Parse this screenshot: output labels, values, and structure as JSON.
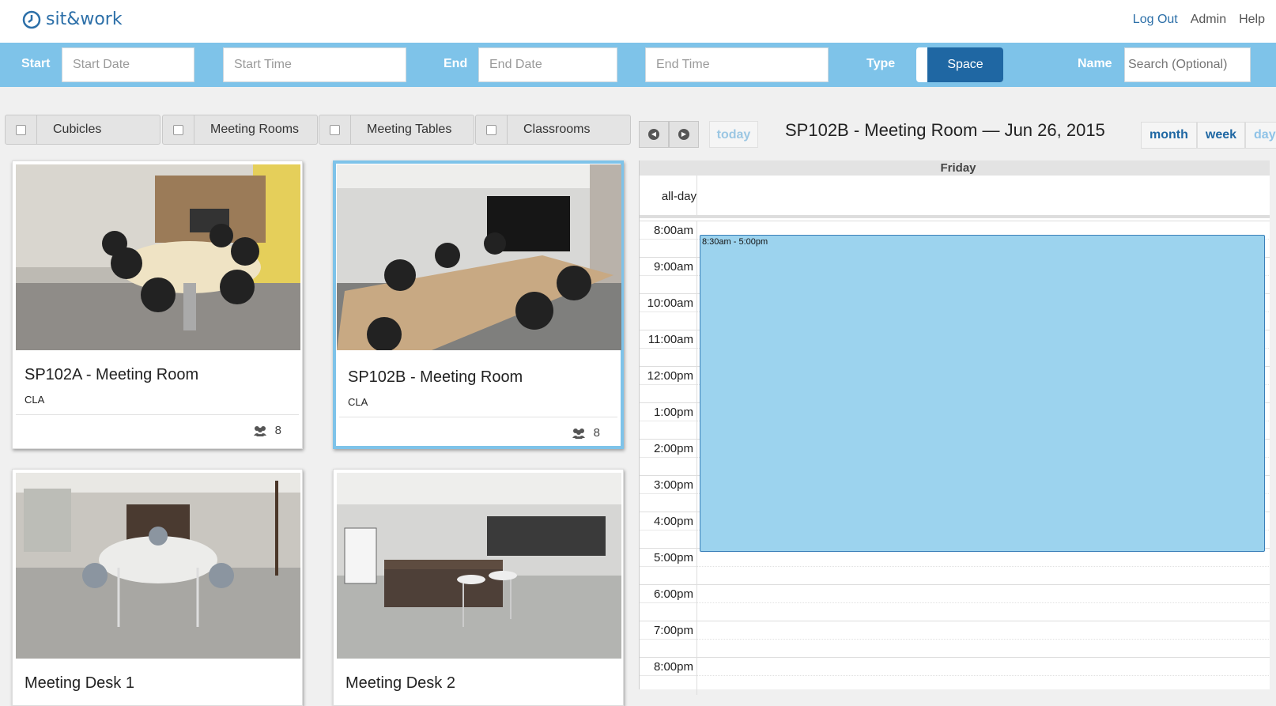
{
  "header": {
    "logo_text": "sit&work",
    "links": {
      "logout": "Log Out",
      "admin": "Admin",
      "help": "Help"
    }
  },
  "filters": {
    "start_label": "Start",
    "start_date_placeholder": "Start Date",
    "start_time_placeholder": "Start Time",
    "end_label": "End",
    "end_date_placeholder": "End Date",
    "end_time_placeholder": "End Time",
    "type_label": "Type",
    "type_value": "Space",
    "name_label": "Name",
    "name_placeholder": "Search (Optional)"
  },
  "categories": [
    "Cubicles",
    "Meeting Rooms",
    "Meeting Tables",
    "Classrooms"
  ],
  "cards": [
    {
      "title": "SP102A - Meeting Room",
      "subtitle": "CLA",
      "capacity": "8"
    },
    {
      "title": "SP102B - Meeting Room",
      "subtitle": "CLA",
      "capacity": "8"
    },
    {
      "title": "Meeting Desk 1"
    },
    {
      "title": "Meeting Desk 2"
    }
  ],
  "calendar": {
    "today_label": "today",
    "title": "SP102B - Meeting Room — Jun 26, 2015",
    "views": {
      "month": "month",
      "week": "week",
      "day": "day"
    },
    "day_header": "Friday",
    "allday_label": "all-day",
    "times": [
      "8:00am",
      "9:00am",
      "10:00am",
      "11:00am",
      "12:00pm",
      "1:00pm",
      "2:00pm",
      "3:00pm",
      "4:00pm",
      "5:00pm",
      "6:00pm",
      "7:00pm",
      "8:00pm"
    ],
    "event": {
      "time": "8:30am - 5:00pm"
    }
  },
  "colors": {
    "accent": "#7ec3e9",
    "brand": "#2c6fa8",
    "selected": "#1f67a3",
    "event": "#9cd3ee"
  }
}
